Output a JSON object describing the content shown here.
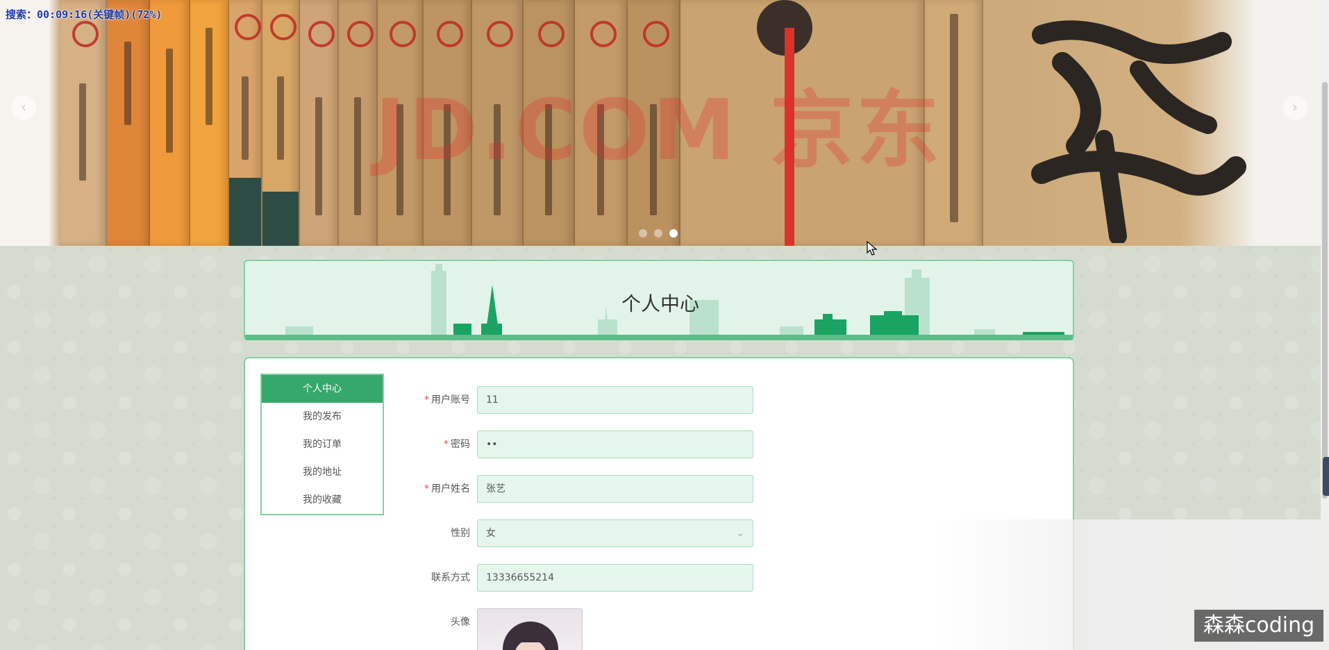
{
  "recording_overlay": "搜索：00:09:16(关键帧)(72%)",
  "banner": {
    "watermark": "JD.COM 京东",
    "prev_arrow": "‹",
    "next_arrow": "›",
    "dots": 3,
    "active_dot": 2
  },
  "page_title": "个人中心",
  "menu": {
    "items": [
      {
        "label": "个人中心",
        "active": true
      },
      {
        "label": "我的发布",
        "active": false
      },
      {
        "label": "我的订单",
        "active": false
      },
      {
        "label": "我的地址",
        "active": false
      },
      {
        "label": "我的收藏",
        "active": false
      }
    ]
  },
  "form": {
    "account": {
      "label": "用户账号",
      "required": true,
      "value": "11"
    },
    "password": {
      "label": "密码",
      "required": true,
      "value": "••"
    },
    "name": {
      "label": "用户姓名",
      "required": true,
      "value": "张艺"
    },
    "gender": {
      "label": "性别",
      "required": false,
      "value": "女"
    },
    "phone": {
      "label": "联系方式",
      "required": false,
      "value": "13336655214"
    },
    "avatar": {
      "label": "头像"
    }
  },
  "badge": "森森coding",
  "icons": {
    "chevron": "chevron-down-icon",
    "cursor": "mouse-cursor-icon"
  },
  "colors": {
    "accent": "#37a86b",
    "border": "#84cfa4",
    "input_bg": "#e5f6ec",
    "required": "#e84d4d"
  }
}
